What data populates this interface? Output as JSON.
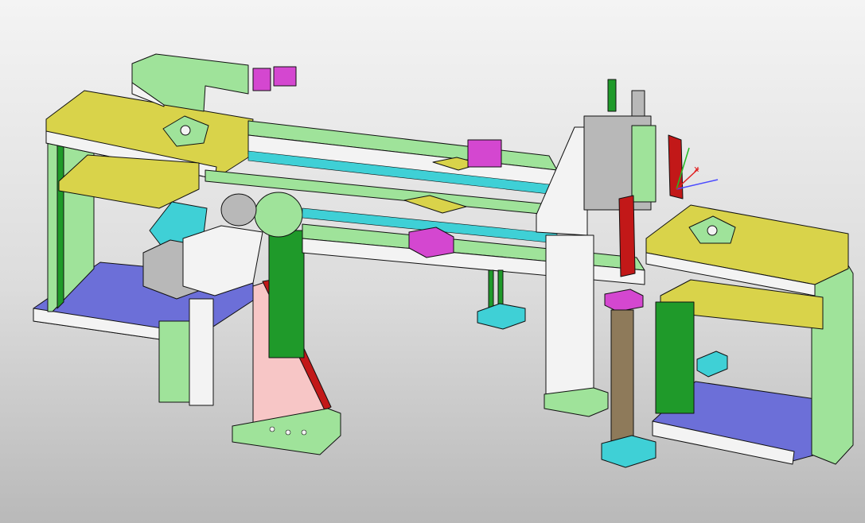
{
  "viewport": {
    "background": "gradient-grey"
  },
  "palette": {
    "frame_green": "#9fe39a",
    "frame_green_dark": "#1f9a2a",
    "deck_yellow": "#d9d34a",
    "plate_blue": "#6c6fd8",
    "plate_pink": "#f7c6c6",
    "rib_red": "#c21818",
    "cyl_cyan": "#3fd0d6",
    "part_magenta": "#d447d0",
    "steel_white": "#f3f3f3",
    "steel_grey": "#b8b8b8",
    "rail_brown": "#8e7a5a"
  },
  "icons": {
    "triad": "axis-triad-icon"
  }
}
